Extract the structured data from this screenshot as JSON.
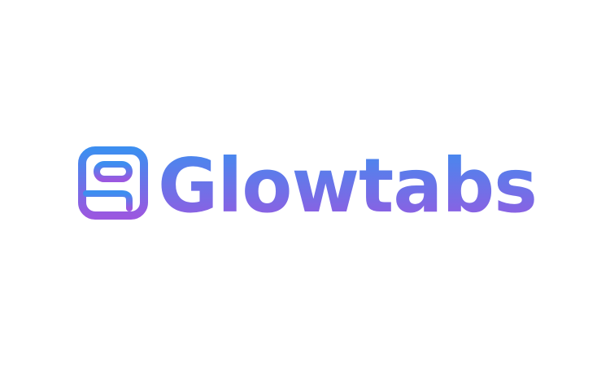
{
  "logo": {
    "name": "Glowtabs",
    "mark_icon": "tabs-window-icon"
  },
  "colors": {
    "gradient_top": "#3d8ef0",
    "gradient_bottom": "#9a58e0",
    "background": "#ffffff"
  }
}
